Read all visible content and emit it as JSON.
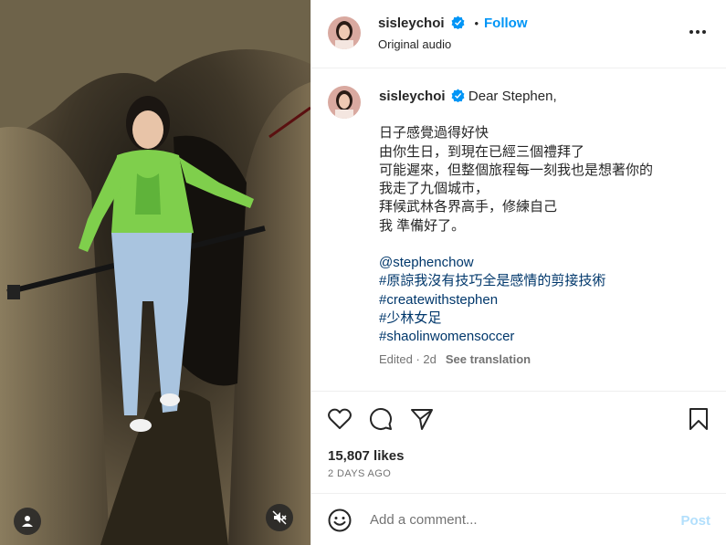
{
  "post": {
    "username": "sisleychoi",
    "follow_label": "Follow",
    "separator": "•",
    "audio_label": "Original audio",
    "caption": {
      "greeting": "Dear Stephen,",
      "lines": [
        "日子感覺過得好快",
        "由你生日，到現在已經三個禮拜了",
        "可能遲來，但整個旅程每一刻我也是想著你的",
        "我走了九個城市，",
        "拜候武林各界高手，修練自己",
        "我 準備好了。"
      ],
      "mention": "@stephenchow",
      "hashtags": [
        "#原諒我沒有技巧全是感情的剪接技術",
        "#createwithstephen",
        "#少林女足",
        "#shaolinwomensoccer"
      ]
    },
    "edited_label": "Edited · 2d",
    "translate_label": "See translation",
    "likes": "15,807 likes",
    "date": "2 DAYS AGO",
    "comment_placeholder": "Add a comment...",
    "post_label": "Post"
  },
  "colors": {
    "accent": "#0095f6",
    "verified": "#0095f6",
    "link": "#00376b",
    "post_disabled": "#b2dffc"
  },
  "icons": [
    "more-icon",
    "verified-icon",
    "heart-icon",
    "comment-icon",
    "share-icon",
    "bookmark-icon",
    "emoji-icon",
    "user-tag-icon",
    "mute-icon"
  ]
}
